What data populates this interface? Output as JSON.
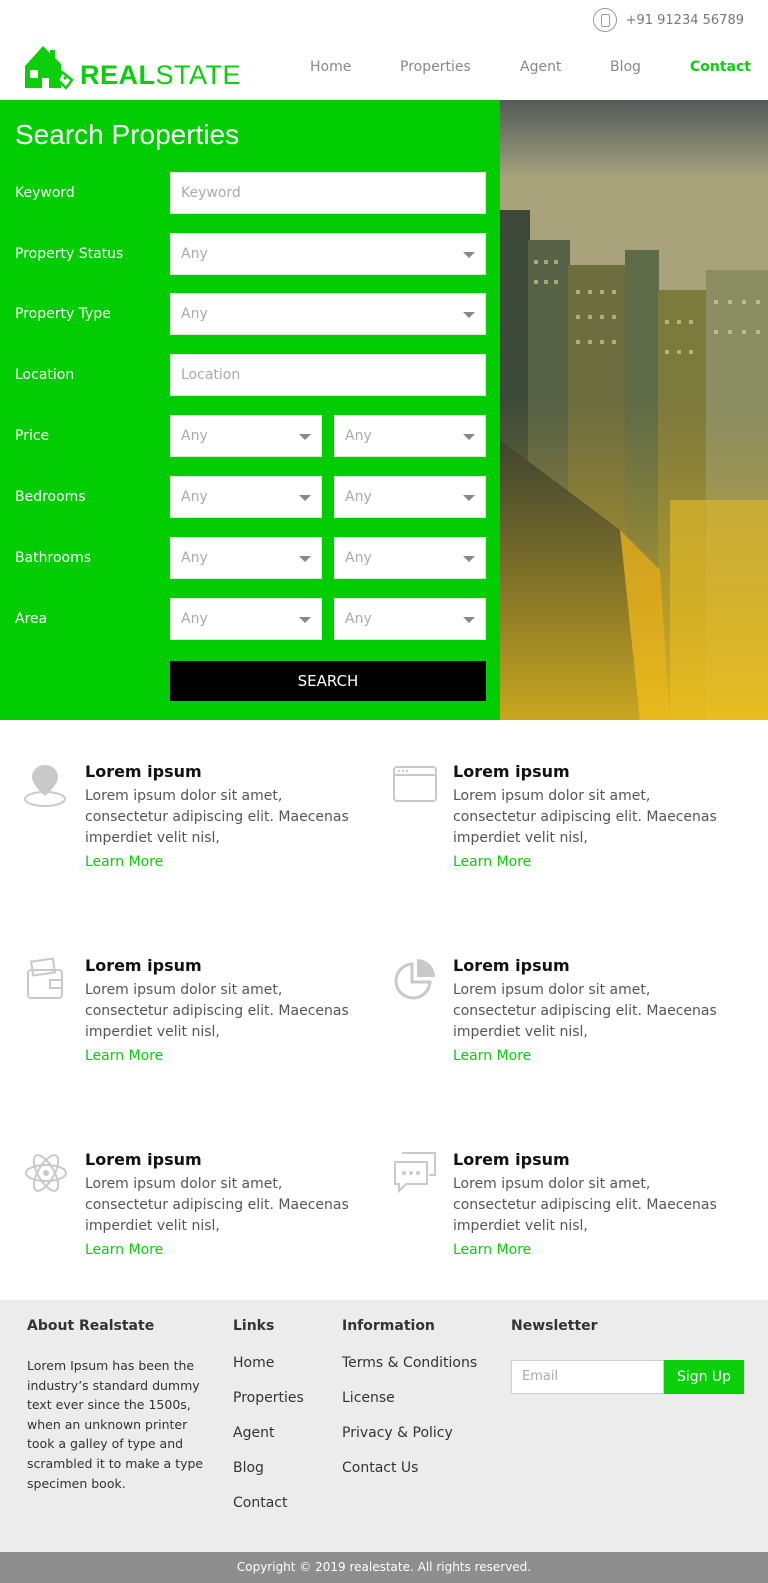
{
  "top": {
    "phone": "+91 91234 56789"
  },
  "brand": {
    "bold": "REAL",
    "light": "STATE",
    "color": "#0bcf0b"
  },
  "nav": [
    "Home",
    "Properties",
    "Agent",
    "Blog",
    "Contact"
  ],
  "search": {
    "title": "Search Properties",
    "keyword_label": "Keyword",
    "keyword_placeholder": "Keyword",
    "status_label": "Property Status",
    "status_value": "Any",
    "type_label": "Property Type",
    "type_value": "Any",
    "location_label": "Location",
    "location_placeholder": "Location",
    "price_label": "Price",
    "price_min": "Any",
    "price_max": "Any",
    "bed_label": "Bedrooms",
    "bed_min": "Any",
    "bed_max": "Any",
    "bath_label": "Bathrooms",
    "bath_min": "Any",
    "bath_max": "Any",
    "area_label": "Area",
    "area_min": "Any",
    "area_max": "Any",
    "button": "SEARCH"
  },
  "features": [
    {
      "icon": "map-pin-icon",
      "title": "Lorem ipsum",
      "text": "Lorem ipsum dolor sit amet, consectetur adipiscing elit. Maecenas imperdiet velit nisl,",
      "link": "Learn More"
    },
    {
      "icon": "browser-window-icon",
      "title": "Lorem ipsum",
      "text": "Lorem ipsum dolor sit amet, consectetur adipiscing elit. Maecenas imperdiet velit nisl,",
      "link": "Learn More"
    },
    {
      "icon": "wallet-icon",
      "title": "Lorem ipsum",
      "text": "Lorem ipsum dolor sit amet, consectetur adipiscing elit. Maecenas imperdiet velit nisl,",
      "link": "Learn More"
    },
    {
      "icon": "pie-chart-icon",
      "title": "Lorem ipsum",
      "text": "Lorem ipsum dolor sit amet, consectetur adipiscing elit. Maecenas imperdiet velit nisl,",
      "link": "Learn More"
    },
    {
      "icon": "atom-icon",
      "title": "Lorem ipsum",
      "text": "Lorem ipsum dolor sit amet, consectetur adipiscing elit. Maecenas imperdiet velit nisl,",
      "link": "Learn More"
    },
    {
      "icon": "chat-bubbles-icon",
      "title": "Lorem ipsum",
      "text": "Lorem ipsum dolor sit amet, consectetur adipiscing elit. Maecenas imperdiet velit nisl,",
      "link": "Learn More"
    }
  ],
  "footer": {
    "about_title": "About Realstate",
    "about_text": "Lorem Ipsum has been the industry’s standard dummy text ever since the 1500s, when an unknown printer took a galley of type and scrambled it to make a type specimen book.",
    "links_title": "Links",
    "links": [
      "Home",
      "Properties",
      "Agent",
      "Blog",
      "Contact"
    ],
    "info_title": "Information",
    "info": [
      "Terms & Conditions",
      "License",
      "Privacy & Policy",
      "Contact Us"
    ],
    "news_title": "Newsletter",
    "news_placeholder": "Email",
    "news_button": "Sign Up"
  },
  "copyright": "Copyright © 2019 realestate. All rights reserved."
}
